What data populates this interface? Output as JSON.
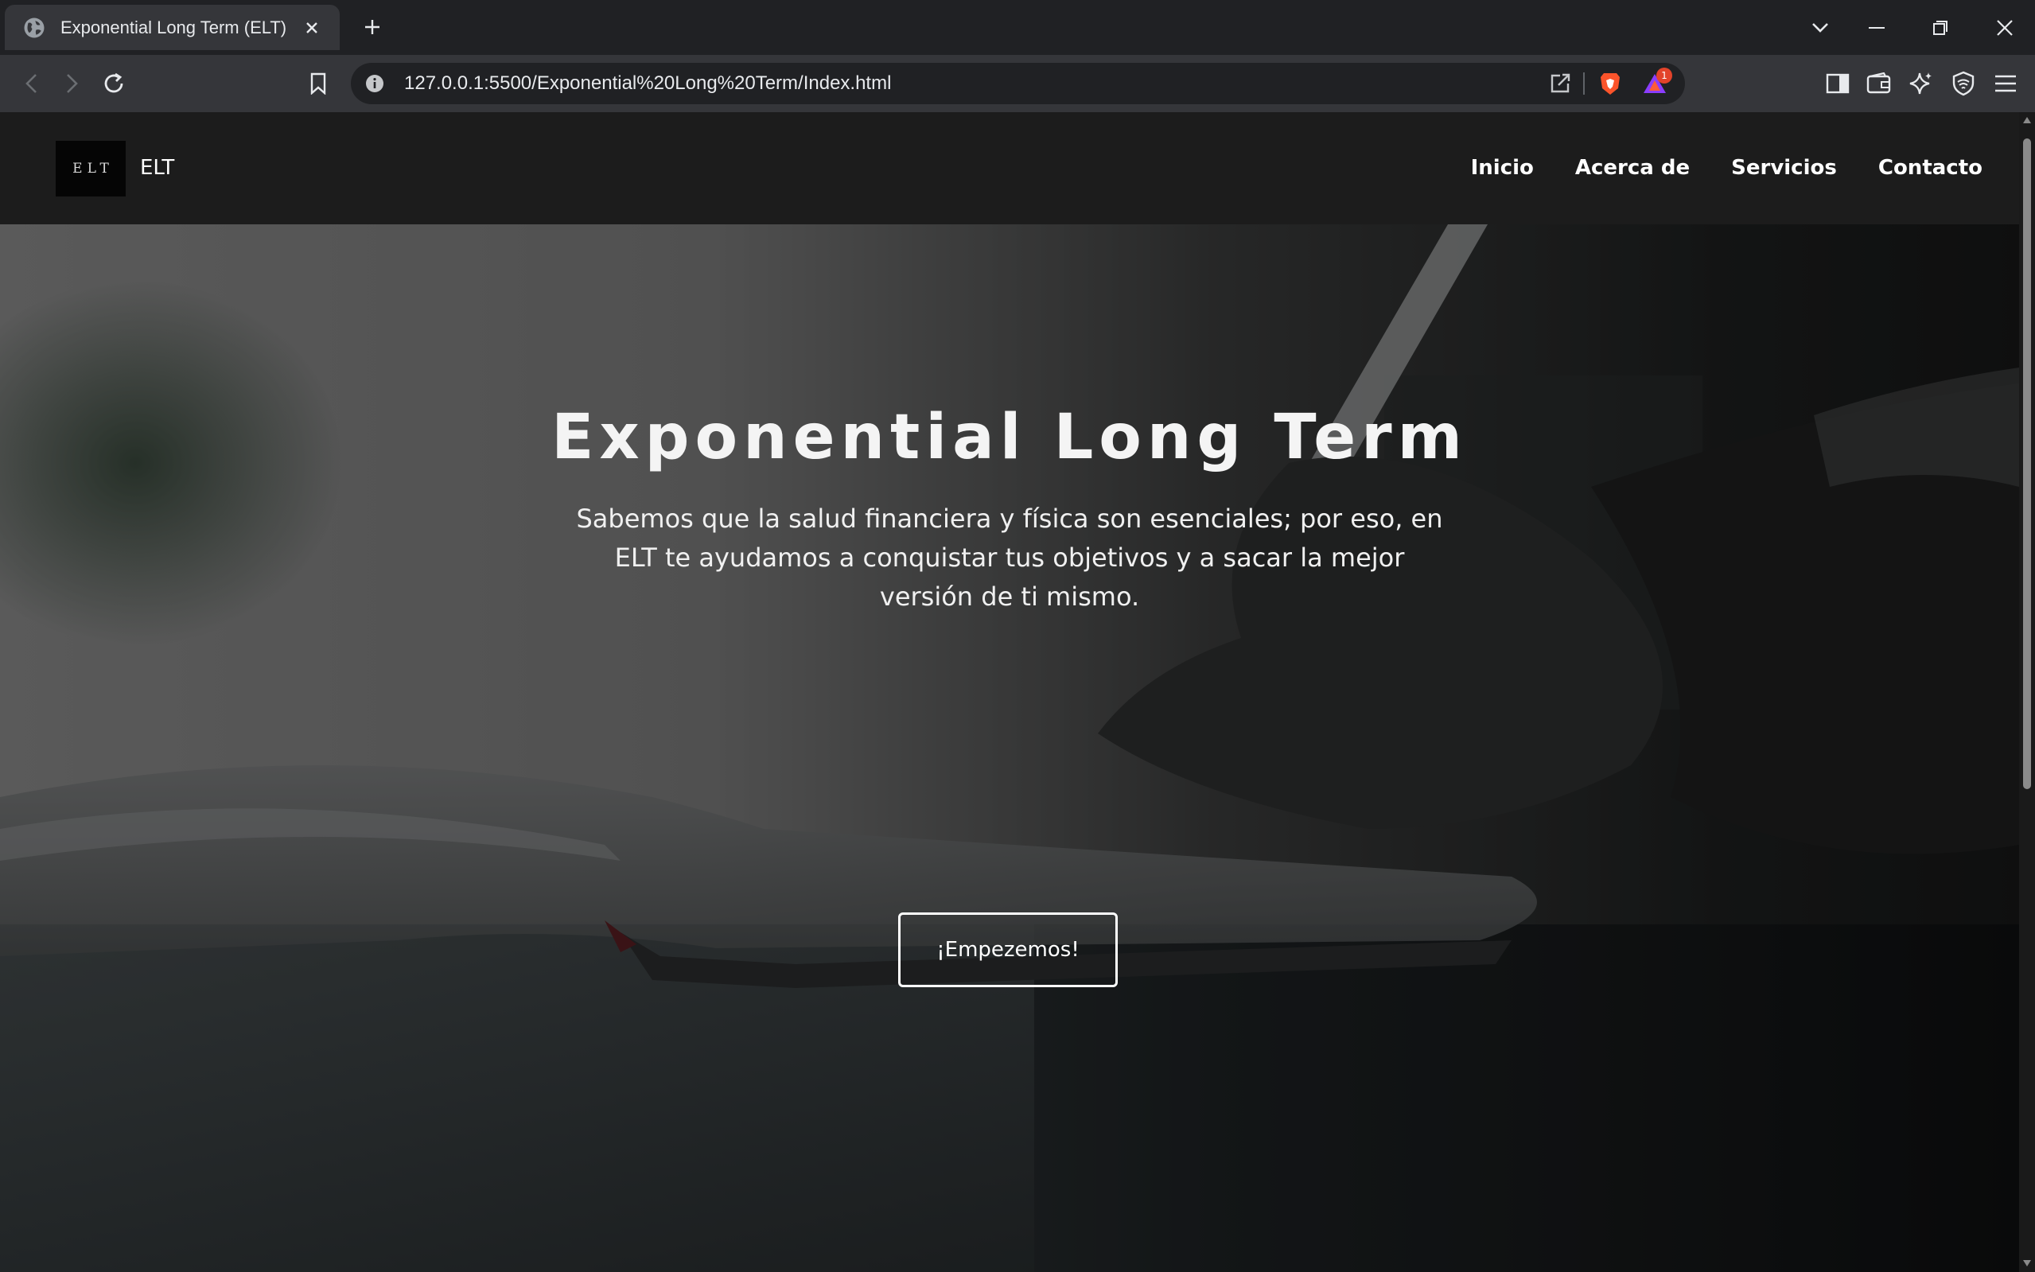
{
  "browser": {
    "tab_title": "Exponential Long Term (ELT)",
    "url": "127.0.0.1:5500/Exponential%20Long%20Term/Index.html",
    "notification_count": "1",
    "icons": [
      "globe-icon",
      "close-icon",
      "plus-icon",
      "chevron-down-icon",
      "minimize-icon",
      "restore-icon",
      "close-window-icon",
      "back-icon",
      "forward-icon",
      "reload-icon",
      "bookmark-icon",
      "info-icon",
      "share-icon",
      "brave-shield-icon",
      "brave-rewards-icon",
      "sidebar-icon",
      "wallet-icon",
      "leo-ai-icon",
      "vpn-icon",
      "menu-icon"
    ]
  },
  "site": {
    "logo_text": "ELT",
    "brand": "ELT",
    "nav": {
      "inicio": "Inicio",
      "acerca": "Acerca de",
      "servicios": "Servicios",
      "contacto": "Contacto"
    },
    "hero": {
      "title": "Exponential Long Term",
      "subtitle": "Sabemos que la salud financiera y física son esenciales; por eso, en ELT te ayudamos a conquistar tus objetivos y a sacar la mejor versión de ti mismo.",
      "cta": "¡Empezemos!"
    }
  },
  "colors": {
    "chrome_dark": "#202124",
    "chrome_toolbar": "#35363a",
    "navbar_bg": "#1c1c1c",
    "text_white": "#ffffff"
  }
}
